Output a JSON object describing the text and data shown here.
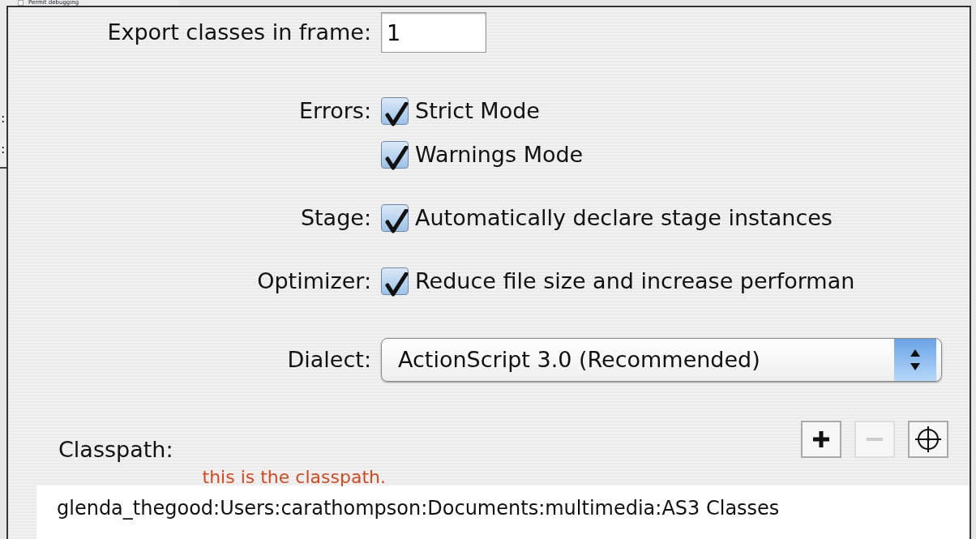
{
  "background_window": {
    "option": {
      "label": "Permit debugging",
      "checked": false
    },
    "label_fragments": [
      ":",
      ":"
    ]
  },
  "export_frame": {
    "label": "Export classes in frame:",
    "value": "1"
  },
  "option_groups": [
    {
      "label": "Errors:",
      "options": [
        {
          "label": "Strict Mode",
          "checked": true
        },
        {
          "label": "Warnings Mode",
          "checked": true
        }
      ]
    },
    {
      "label": "Stage:",
      "options": [
        {
          "label": "Automatically declare stage instances",
          "checked": true
        }
      ]
    },
    {
      "label": "Optimizer:",
      "options": [
        {
          "label": "Reduce file size and increase performan",
          "checked": true
        }
      ]
    }
  ],
  "dialect": {
    "label": "Dialect:",
    "value": "ActionScript 3.0 (Recommended)"
  },
  "classpath": {
    "label": "Classpath:",
    "note": "this is the classpath.",
    "buttons": [
      {
        "kind": "add",
        "disabled": false
      },
      {
        "kind": "remove",
        "disabled": true
      },
      {
        "kind": "target",
        "disabled": false
      }
    ],
    "entries": [
      "glenda_thegood:Users:carathompson:Documents:multimedia:AS3 Classes"
    ]
  }
}
